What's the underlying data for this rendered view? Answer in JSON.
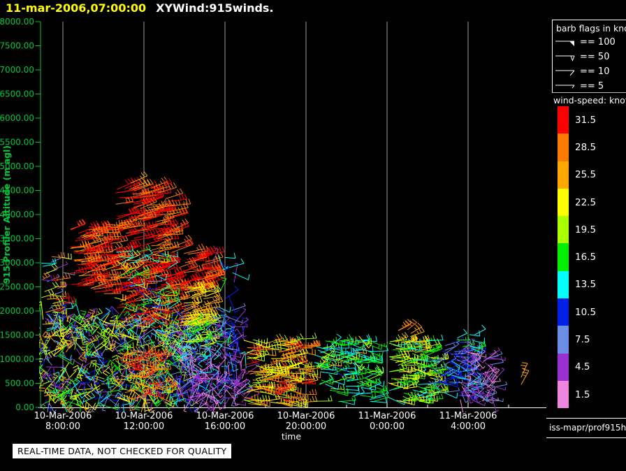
{
  "header": {
    "datetime": "11-mar-2006,07:00:00",
    "plot_name": "XYWind:915winds."
  },
  "axes": {
    "y_label": "915 Profiler Altitude (m agl)",
    "x_label": "time",
    "axis_color": "#00c83c",
    "grid_color": "#9a9a9a",
    "tick_text_color": "#ffffff"
  },
  "legend": {
    "flags_title": "barb flags in knots",
    "flags": [
      {
        "label": "== 100",
        "symbol": "flag"
      },
      {
        "label": "== 50",
        "symbol": "pennant-outline"
      },
      {
        "label": "== 10",
        "symbol": "full-barb"
      },
      {
        "label": "== 5",
        "symbol": "half-barb"
      }
    ],
    "colorbar_title": "wind-speed: knots",
    "colorbar": [
      {
        "label": "31.5",
        "color": "#ff0000"
      },
      {
        "label": "28.5",
        "color": "#ff7b00"
      },
      {
        "label": "25.5",
        "color": "#ffa800"
      },
      {
        "label": "22.5",
        "color": "#ffff00"
      },
      {
        "label": "19.5",
        "color": "#aaff00"
      },
      {
        "label": "16.5",
        "color": "#00f000"
      },
      {
        "label": "13.5",
        "color": "#00ffff"
      },
      {
        "label": "10.5",
        "color": "#0020e8"
      },
      {
        "label": "7.5",
        "color": "#6b8de6"
      },
      {
        "label": "4.5",
        "color": "#9b30d0"
      },
      {
        "label": "1.5",
        "color": "#ee86e0"
      }
    ]
  },
  "footer": {
    "source_id": "iss-mapr/prof915h",
    "notice": "REAL-TIME DATA, NOT CHECKED FOR QUALITY"
  },
  "chart_data": {
    "type": "wind-barb-time-height",
    "title": "XYWind:915winds.",
    "time_axis": {
      "label": "time",
      "start_hour_of_10mar": 6.8,
      "end_hour_of_10mar": 31.9,
      "major_ticks": [
        {
          "hour": 8,
          "date": "10-Mar-2006",
          "time": "8:00:00"
        },
        {
          "hour": 12,
          "date": "10-Mar-2006",
          "time": "12:00:00"
        },
        {
          "hour": 16,
          "date": "10-Mar-2006",
          "time": "16:00:00"
        },
        {
          "hour": 20,
          "date": "10-Mar-2006",
          "time": "20:00:00"
        },
        {
          "hour": 24,
          "date": "11-Mar-2006",
          "time": "0:00:00"
        },
        {
          "hour": 28,
          "date": "11-Mar-2006",
          "time": "4:00:00"
        }
      ],
      "minor_tick_hours": [
        10,
        14,
        18,
        22,
        26,
        30
      ],
      "grid": true
    },
    "altitude_axis": {
      "label": "915 Profiler Altitude (m agl)",
      "min_m": 0,
      "max_m": 8000,
      "tick_step_m": 500,
      "tick_labels": [
        "8000.00",
        "7500.00",
        "7000.00",
        "6500.00",
        "6000.00",
        "5500.00",
        "5000.00",
        "4500.00",
        "4000.00",
        "3500.00",
        "3000.00",
        "2500.00",
        "2000.00",
        "1500.00",
        "1000.00",
        "500.00",
        "0.00"
      ]
    },
    "wind_speed_bin_centers_knots": [
      1.5,
      4.5,
      7.5,
      10.5,
      13.5,
      16.5,
      19.5,
      22.5,
      25.5,
      28.5,
      31.5
    ],
    "clusters": [
      {
        "name": "left-edge-sparse",
        "t": [
          6.85,
          8.05
        ],
        "alt": [
          1450,
          3150
        ],
        "n": 40,
        "spd": [
          4,
          31
        ],
        "dir": [
          -15,
          25
        ],
        "len": [
          13,
          22
        ]
      },
      {
        "name": "low-band-morning",
        "t": [
          6.85,
          10.45
        ],
        "alt": [
          30,
          1950
        ],
        "n": 260,
        "spd": [
          3,
          27
        ],
        "dir": [
          -170,
          170
        ],
        "len": [
          13,
          28
        ]
      },
      {
        "name": "low-band-midday",
        "t": [
          10.45,
          14.3
        ],
        "alt": [
          30,
          2000
        ],
        "n": 300,
        "spd": [
          3,
          25
        ],
        "dir": [
          -170,
          170
        ],
        "len": [
          13,
          28
        ]
      },
      {
        "name": "low-band-afternoon",
        "t": [
          13.8,
          17.1
        ],
        "alt": [
          30,
          1750
        ],
        "n": 200,
        "spd": [
          1,
          15
        ],
        "dir": [
          -170,
          170
        ],
        "len": [
          13,
          28
        ]
      },
      {
        "name": "low-purple-patch",
        "t": [
          14.2,
          17.1
        ],
        "alt": [
          60,
          950
        ],
        "n": 80,
        "spd": [
          1,
          6
        ],
        "dir": [
          -170,
          170
        ],
        "len": [
          12,
          24
        ]
      },
      {
        "name": "low-red-patch",
        "t": [
          10.6,
          12.9
        ],
        "alt": [
          80,
          1150
        ],
        "n": 55,
        "spd": [
          24,
          32
        ],
        "dir": [
          -30,
          30
        ],
        "len": [
          16,
          26
        ]
      },
      {
        "name": "red-mass-morning",
        "t": [
          8.35,
          10.45
        ],
        "alt": [
          2350,
          3800
        ],
        "n": 110,
        "spd": [
          26,
          34
        ],
        "dir": [
          -5,
          25
        ],
        "len": [
          22,
          32
        ]
      },
      {
        "name": "red-column",
        "t": [
          10.45,
          13.4
        ],
        "alt": [
          1600,
          4550
        ],
        "n": 200,
        "spd": [
          27,
          34
        ],
        "dir": [
          0,
          25
        ],
        "len": [
          24,
          34
        ]
      },
      {
        "name": "column-mixed",
        "t": [
          10.5,
          13.2
        ],
        "alt": [
          1500,
          3300
        ],
        "n": 70,
        "spd": [
          8,
          26
        ],
        "dir": [
          -40,
          40
        ],
        "len": [
          16,
          28
        ]
      },
      {
        "name": "column-top-orange",
        "t": [
          11.3,
          11.5
        ],
        "alt": [
          4520,
          4700
        ],
        "n": 2,
        "spd": [
          26,
          28
        ],
        "dir": [
          15,
          25
        ],
        "len": [
          22,
          26
        ]
      },
      {
        "name": "pm-red",
        "t": [
          13.75,
          15.2
        ],
        "alt": [
          2400,
          3200
        ],
        "n": 45,
        "spd": [
          28,
          33
        ],
        "dir": [
          0,
          22
        ],
        "len": [
          22,
          30
        ]
      },
      {
        "name": "pm-orange",
        "t": [
          13.75,
          15.2
        ],
        "alt": [
          1700,
          2500
        ],
        "n": 45,
        "spd": [
          21,
          27
        ],
        "dir": [
          0,
          25
        ],
        "len": [
          20,
          28
        ]
      },
      {
        "name": "pm-yellow",
        "t": [
          13.8,
          15.1
        ],
        "alt": [
          1250,
          1820
        ],
        "n": 30,
        "spd": [
          16,
          24
        ],
        "dir": [
          -5,
          30
        ],
        "len": [
          18,
          26
        ]
      },
      {
        "name": "sparse-1600",
        "t": [
          15.3,
          16.55
        ],
        "alt": [
          1150,
          3200
        ],
        "n": 28,
        "spd": [
          3,
          17
        ],
        "dir": [
          -90,
          90
        ],
        "len": [
          15,
          28
        ]
      },
      {
        "name": "evening-orange",
        "t": [
          16.9,
          19.9
        ],
        "alt": [
          80,
          1420
        ],
        "n": 150,
        "spd": [
          19,
          32
        ],
        "dir": [
          -20,
          20
        ],
        "len": [
          18,
          28
        ]
      },
      {
        "name": "night-green",
        "t": [
          20.3,
          23.3
        ],
        "alt": [
          80,
          1420
        ],
        "n": 120,
        "spd": [
          12,
          19
        ],
        "dir": [
          -25,
          25
        ],
        "len": [
          16,
          26
        ]
      },
      {
        "name": "night-stray",
        "t": [
          20.4,
          22.9
        ],
        "alt": [
          700,
          1500
        ],
        "n": 12,
        "spd": [
          8,
          27
        ],
        "dir": [
          -60,
          60
        ],
        "len": [
          16,
          24
        ]
      },
      {
        "name": "midnight-yellow",
        "t": [
          24.05,
          26.35
        ],
        "alt": [
          120,
          1400
        ],
        "n": 130,
        "spd": [
          14,
          24
        ],
        "dir": [
          -25,
          25
        ],
        "len": [
          16,
          26
        ]
      },
      {
        "name": "midnight-orange-top",
        "t": [
          24.3,
          25.4
        ],
        "alt": [
          1230,
          1650
        ],
        "n": 8,
        "spd": [
          25,
          28
        ],
        "dir": [
          10,
          40
        ],
        "len": [
          16,
          22
        ]
      },
      {
        "name": "midnight-blue-stray",
        "t": [
          25.9,
          26.6
        ],
        "alt": [
          400,
          1200
        ],
        "n": 10,
        "spd": [
          7,
          12
        ],
        "dir": [
          -60,
          60
        ],
        "len": [
          16,
          24
        ]
      },
      {
        "name": "early-blue",
        "t": [
          26.7,
          28.2
        ],
        "alt": [
          250,
          1350
        ],
        "n": 70,
        "spd": [
          7,
          13
        ],
        "dir": [
          -40,
          40
        ],
        "len": [
          16,
          28
        ]
      },
      {
        "name": "early-purple",
        "t": [
          27.6,
          29.25
        ],
        "alt": [
          80,
          1150
        ],
        "n": 85,
        "spd": [
          1,
          7
        ],
        "dir": [
          -80,
          80
        ],
        "len": [
          13,
          24
        ]
      },
      {
        "name": "early-cyan-top",
        "t": [
          27.0,
          28.6
        ],
        "alt": [
          1100,
          1520
        ],
        "n": 10,
        "spd": [
          13,
          16
        ],
        "dir": [
          -30,
          30
        ],
        "len": [
          14,
          20
        ]
      },
      {
        "name": "lone-orange",
        "t": [
          30.6,
          30.7
        ],
        "alt": [
          470,
          640
        ],
        "n": 2,
        "spd": [
          25,
          27
        ],
        "dir": [
          55,
          75
        ],
        "len": [
          22,
          26
        ]
      }
    ]
  }
}
